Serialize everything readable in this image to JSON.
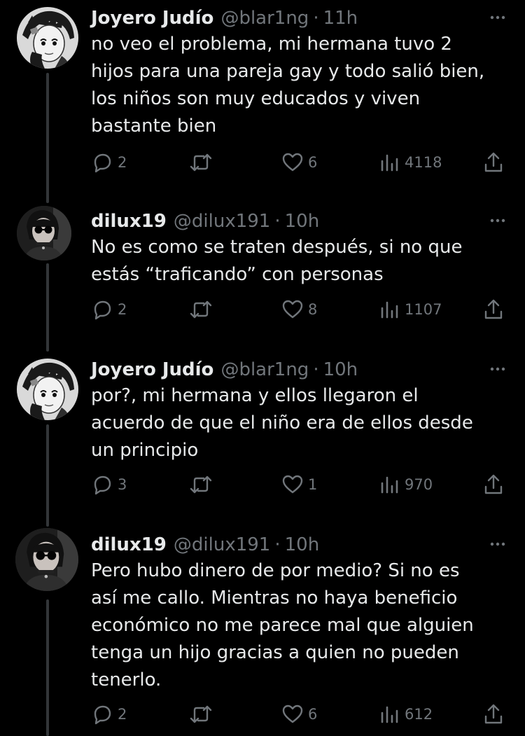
{
  "colors": {
    "background": "#000000",
    "text_primary": "#e7e9ea",
    "text_secondary": "#71767b",
    "thread_line": "#333639"
  },
  "tweets": [
    {
      "author_name": "Joyero Judío",
      "handle": "@blar1ng",
      "separator": "·",
      "time": "11h",
      "text": "no veo el problema, mi hermana tuvo 2\nhijos para una pareja gay y todo salió bien,\nlos niños son muy educados y viven\nbastante bien",
      "replies": "2",
      "likes": "6",
      "views": "4118",
      "avatar": "manga-boy-avatar"
    },
    {
      "author_name": "dilux19",
      "handle": "@dilux191",
      "separator": "·",
      "time": "10h",
      "text": "No es como se traten después, si no que\nestás “traficando” con personas",
      "replies": "2",
      "likes": "8",
      "views": "1107",
      "avatar": "girl-sunglasses-avatar"
    },
    {
      "author_name": "Joyero Judío",
      "handle": "@blar1ng",
      "separator": "·",
      "time": "10h",
      "text": "por?, mi hermana y ellos llegaron el\nacuerdo de que el niño era de ellos desde\nun principio",
      "replies": "3",
      "likes": "1",
      "views": "970",
      "avatar": "manga-boy-avatar"
    },
    {
      "author_name": "dilux19",
      "handle": "@dilux191",
      "separator": "·",
      "time": "10h",
      "text": "Pero hubo dinero de por medio? Si no es\nasí me callo. Mientras no haya beneficio\neconómico no me parece mal que alguien\ntenga un hijo gracias a quien no pueden\ntenerlo.",
      "replies": "2",
      "likes": "6",
      "views": "612",
      "avatar": "girl-sunglasses-avatar"
    }
  ],
  "icons": {
    "more": "more-icon",
    "reply": "reply-icon",
    "retweet": "retweet-icon",
    "like": "heart-icon",
    "views": "views-icon",
    "share": "share-icon"
  }
}
